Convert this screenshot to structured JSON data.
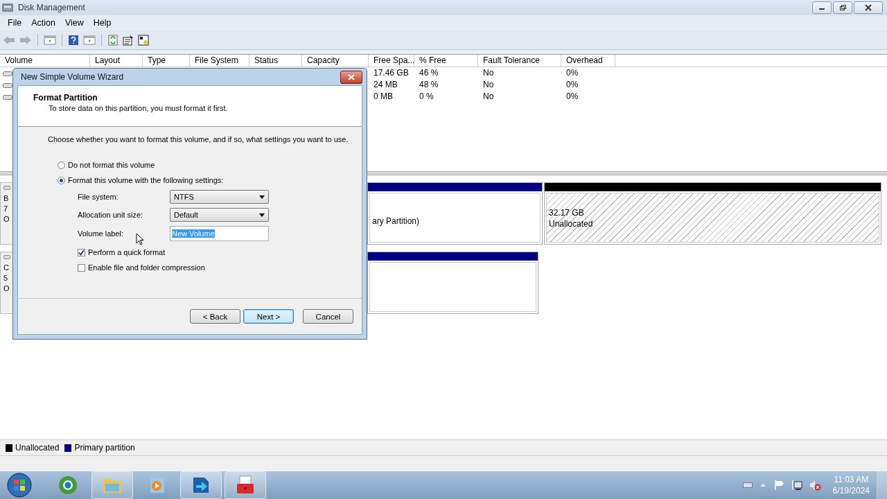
{
  "window": {
    "title": "Disk Management"
  },
  "menu": [
    "File",
    "Action",
    "View",
    "Help"
  ],
  "table": {
    "columns": [
      "Volume",
      "Layout",
      "Type",
      "File System",
      "Status",
      "Capacity",
      "Free Spa...",
      "% Free",
      "Fault Tolerance",
      "Overhead"
    ],
    "rows": [
      {
        "free_space": "17.46 GB",
        "percent_free": "46 %",
        "fault_tolerance": "No",
        "overhead": "0%"
      },
      {
        "free_space": "24 MB",
        "percent_free": "48 %",
        "fault_tolerance": "No",
        "overhead": "0%"
      },
      {
        "free_space": "0 MB",
        "percent_free": "0 %",
        "fault_tolerance": "No",
        "overhead": "0%"
      }
    ]
  },
  "disks": [
    {
      "label_lines": [
        "B",
        "7",
        "O"
      ],
      "partitions": [
        {
          "kind": "primary",
          "lines": [
            "ary Partition)"
          ]
        },
        {
          "kind": "unallocated",
          "lines": [
            "32.17 GB",
            "Unallocated"
          ]
        }
      ]
    },
    {
      "label_lines": [
        "C",
        "5",
        "O"
      ],
      "partitions": [
        {
          "kind": "primary"
        }
      ]
    }
  ],
  "legend": [
    {
      "label": "Unallocated",
      "color": "#000000"
    },
    {
      "label": "Primary partition",
      "color": "#000080"
    }
  ],
  "dialog": {
    "title": "New Simple Volume Wizard",
    "heading": "Format Partition",
    "subtitle": "To store data on this partition, you must format it first.",
    "prompt": "Choose whether you want to format this volume, and if so, what settings you want to use.",
    "options": [
      {
        "label": "Do not format this volume",
        "selected": false
      },
      {
        "label": "Format this volume with the following settings:",
        "selected": true
      }
    ],
    "settings": [
      {
        "label": "File system:",
        "value": "NTFS",
        "kind": "dropdown"
      },
      {
        "label": "Allocation unit size:",
        "value": "Default",
        "kind": "dropdown"
      },
      {
        "label": "Volume label:",
        "value": "New Volume",
        "kind": "text"
      }
    ],
    "checkboxes": [
      {
        "label": "Perform a quick format",
        "checked": true
      },
      {
        "label": "Enable file and folder compression",
        "checked": false
      }
    ],
    "buttons": [
      {
        "label": "< Back",
        "kind": "normal"
      },
      {
        "label": "Next >",
        "kind": "default"
      },
      {
        "label": "Cancel",
        "kind": "normal"
      }
    ]
  },
  "taskbar": {
    "apps": [
      {
        "kind": "browser",
        "open": false
      },
      {
        "kind": "folder",
        "open": true
      },
      {
        "kind": "media",
        "open": false
      },
      {
        "kind": "arrow",
        "open": true
      },
      {
        "kind": "toolbox",
        "open": true
      }
    ],
    "time": "11:03 AM",
    "date": "6/19/2024"
  }
}
